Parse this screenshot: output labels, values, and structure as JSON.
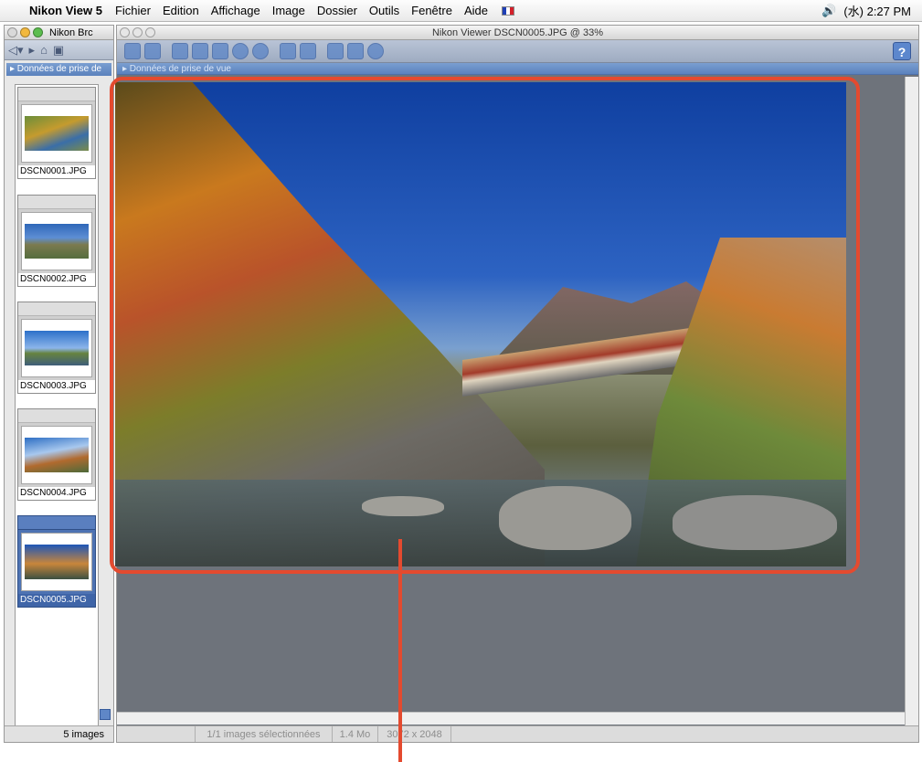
{
  "menubar": {
    "app_name": "Nikon View 5",
    "items": [
      "Fichier",
      "Edition",
      "Affichage",
      "Image",
      "Dossier",
      "Outils",
      "Fenêtre",
      "Aide"
    ],
    "volume_icon": "speaker-icon",
    "clock": "(水) 2:27 PM"
  },
  "browser": {
    "title": "Nikon Brc",
    "section_label": "▸ Données de prise de",
    "thumbnails": [
      {
        "name": "DSCN0001.JPG",
        "selected": false
      },
      {
        "name": "DSCN0002.JPG",
        "selected": false
      },
      {
        "name": "DSCN0003.JPG",
        "selected": false
      },
      {
        "name": "DSCN0004.JPG",
        "selected": false
      },
      {
        "name": "DSCN0005.JPG",
        "selected": true
      }
    ],
    "count": "5 images"
  },
  "viewer": {
    "title": "Nikon Viewer DSCN0005.JPG @ 33%",
    "section_label": "▸ Données de prise de vue",
    "help_label": "?",
    "status": {
      "selection": "1/1 images sélectionnées",
      "size": "1.4 Mo",
      "dimensions": "3072 x 2048"
    }
  },
  "colors": {
    "highlight": "#e44a2f",
    "selection": "#4e73b3",
    "background": "#6e737b"
  }
}
